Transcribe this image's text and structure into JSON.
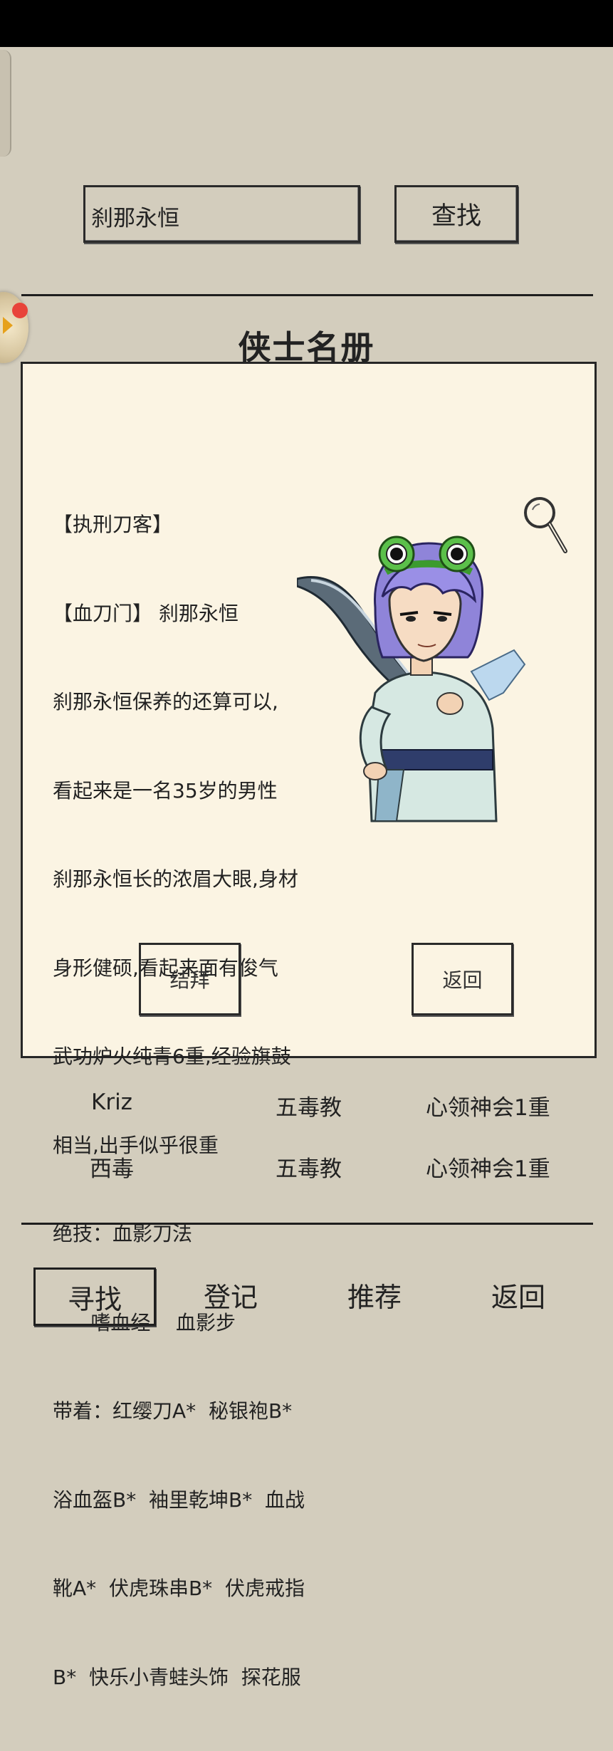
{
  "search": {
    "value": "刹那永恒",
    "button_label": "查找"
  },
  "roster_title": "侠士名册",
  "profile": {
    "lines": [
      "【执刑刀客】",
      "【血刀门】 刹那永恒",
      "刹那永恒保养的还算可以,",
      "看起来是一名35岁的男性",
      "刹那永恒长的浓眉大眼,身材",
      "身形健硕,看起来面有俊气",
      "武功炉火纯青6重,经验旗鼓",
      "相当,出手似乎很重",
      "绝技：血影刀法",
      "      嗜血经    血影步",
      "带着：红缨刀A*  秘银袍B*",
      "浴血盔B*  袖里乾坤B*  血战",
      "靴A*  伏虎珠串B*  伏虎戒指",
      "B*  快乐小青蛙头饰  探花服"
    ],
    "befriend_label": "结拜",
    "back_label": "返回"
  },
  "list": [
    {
      "name": "Kriz",
      "sect": "五毒教",
      "skill": "心领神会1重"
    },
    {
      "name": "西毒",
      "sect": "五毒教",
      "skill": "心领神会1重"
    }
  ],
  "bottom_nav": [
    {
      "label": "寻找",
      "active": true
    },
    {
      "label": "登记",
      "active": false
    },
    {
      "label": "推荐",
      "active": false
    },
    {
      "label": "返回",
      "active": false
    }
  ],
  "icons": {
    "magnifier": "magnifier-icon",
    "handle": "side-handle-arrow-icon"
  },
  "colors": {
    "background": "#d3cdbd",
    "card": "#fbf4e3",
    "ink": "#222222",
    "notification": "#e8443a"
  }
}
